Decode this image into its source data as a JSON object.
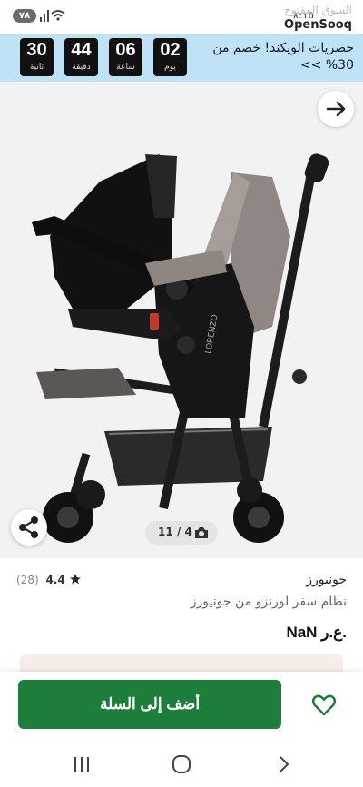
{
  "status_bar": {
    "battery": "٧٨",
    "time": "٨:١٥"
  },
  "watermark": {
    "arabic": "السوق المفتوح",
    "brand": "OpenSooq"
  },
  "promo": {
    "countdown": [
      {
        "value": "30",
        "label": "ثانية"
      },
      {
        "value": "44",
        "label": "دقيقة"
      },
      {
        "value": "06",
        "label": "ساعة"
      },
      {
        "value": "02",
        "label": "يوم"
      }
    ],
    "text": "حصريات الويكند! خصم من 30% >>",
    "background": "#bfe2f6"
  },
  "gallery": {
    "counter": "11 / 4"
  },
  "product": {
    "brand": "جونيورز",
    "title": "نظام سفر لورنزو من جونيورز",
    "rating": "4.4",
    "review_count": "(28)",
    "price": "NaN ع.ر.",
    "stroller_logo": "LORENZO"
  },
  "actions": {
    "add_to_cart": "أضف إلى السلة",
    "accent": "#1d7d3b"
  },
  "icons": {
    "next": "arrow-right-icon",
    "share": "share-icon",
    "camera": "camera-icon",
    "star": "star-icon",
    "heart": "heart-icon"
  }
}
